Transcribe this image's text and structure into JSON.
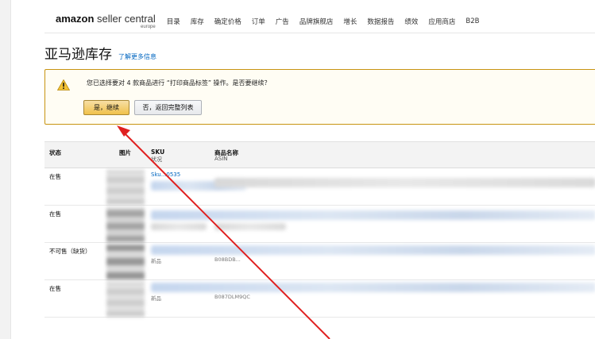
{
  "header": {
    "logo_brand": "amazon",
    "logo_product": "seller central",
    "logo_region": "europe",
    "nav": [
      "目录",
      "库存",
      "确定价格",
      "订单",
      "广告",
      "品牌旗舰店",
      "增长",
      "数据报告",
      "绩效",
      "应用商店",
      "B2B"
    ]
  },
  "page": {
    "title": "亚马逊库存",
    "learn_more": "了解更多信息"
  },
  "alert": {
    "message": "您已选择要对 4 款商品进行 “打印商品标签” 操作。是否要继续？",
    "confirm_label": "是，继续",
    "back_label": "否，返回完整列表"
  },
  "table": {
    "headers": {
      "status": "状态",
      "image": "图片",
      "sku": "SKU",
      "sku_sub": "状况",
      "name": "商品名称",
      "name_sub": "ASIN"
    },
    "rows": [
      {
        "status": "在售",
        "sku_fragment": "Sku...0535",
        "condition": "",
        "asin_fragment": ""
      },
      {
        "status": "在售",
        "sku_fragment": "",
        "condition": "",
        "asin_fragment": ""
      },
      {
        "status": "不可售（缺货）",
        "sku_fragment": "",
        "condition": "新品",
        "asin_fragment": "B08BDB..."
      },
      {
        "status": "在售",
        "sku_fragment": "",
        "condition": "新品",
        "asin_fragment": "B087DLM9QC"
      }
    ]
  },
  "colors": {
    "link": "#0066c0",
    "alert_border": "#c89411",
    "primary_button": "#f0c14b",
    "annotation_arrow": "#e02020"
  },
  "icons": {
    "warning": "warning-triangle-icon",
    "annotation": "red-arrow-annotation"
  }
}
